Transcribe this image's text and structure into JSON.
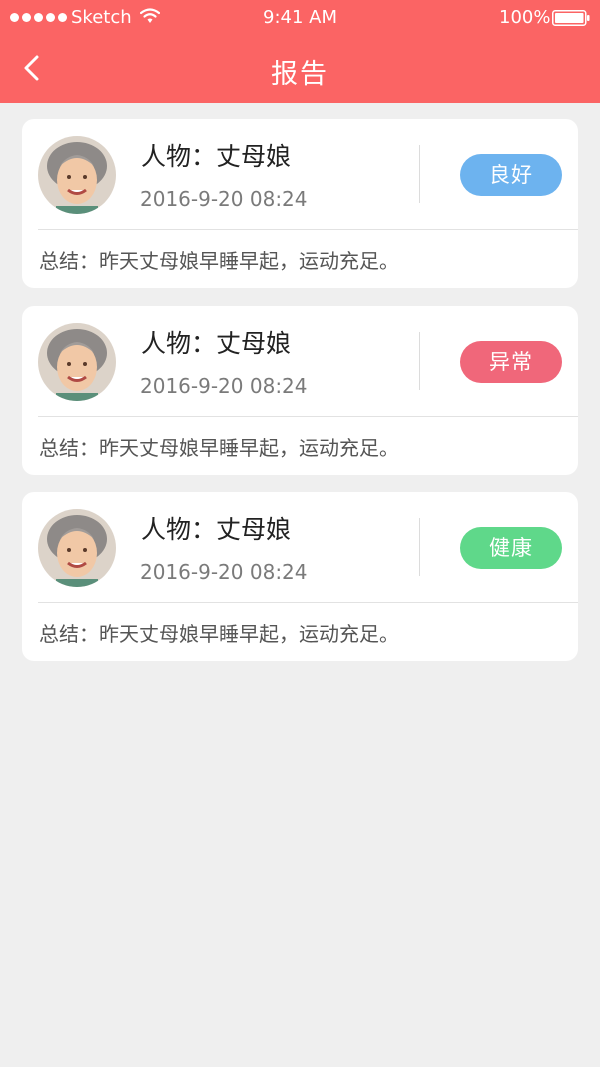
{
  "status_bar": {
    "carrier": "Sketch",
    "time": "9:41 AM",
    "battery": "100%"
  },
  "nav": {
    "title": "报告",
    "back_icon": "chevron-left-icon"
  },
  "reports": [
    {
      "person": "人物：丈母娘",
      "time": "2016-9-20 08:24",
      "status": "良好",
      "status_color": "#6db3ef",
      "summary": "总结：昨天丈母娘早睡早起，运动充足。"
    },
    {
      "person": "人物：丈母娘",
      "time": "2016-9-20 08:24",
      "status": "异常",
      "status_color": "#f0677a",
      "summary": "总结：昨天丈母娘早睡早起，运动充足。"
    },
    {
      "person": "人物：丈母娘",
      "time": "2016-9-20 08:24",
      "status": "健康",
      "status_color": "#5fd88a",
      "summary": "总结：昨天丈母娘早睡早起，运动充足。"
    }
  ],
  "colors": {
    "header": "#fb6464",
    "background": "#efefef"
  }
}
